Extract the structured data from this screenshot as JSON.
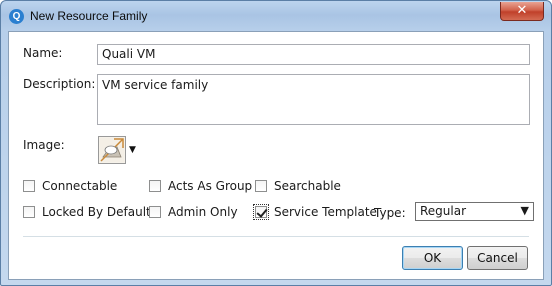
{
  "window": {
    "title": "New Resource Family",
    "app_icon": "Q",
    "close_glyph": "✕"
  },
  "fields": {
    "name": {
      "label": "Name:",
      "value": "Quali VM"
    },
    "description": {
      "label": "Description:",
      "value": "VM service family"
    },
    "image": {
      "label": "Image:",
      "icon": "image-icon"
    }
  },
  "checkboxes": {
    "connectable": {
      "label": "Connectable",
      "checked": false
    },
    "acts_as_group": {
      "label": "Acts As Group",
      "checked": false
    },
    "searchable": {
      "label": "Searchable",
      "checked": false
    },
    "locked_by_default": {
      "label": "Locked By Default",
      "checked": false
    },
    "admin_only": {
      "label": "Admin Only",
      "checked": false
    },
    "service_template": {
      "label": "Service Template",
      "checked": true
    }
  },
  "type": {
    "label": "Type:",
    "selected": "Regular"
  },
  "buttons": {
    "ok": "OK",
    "cancel": "Cancel"
  }
}
